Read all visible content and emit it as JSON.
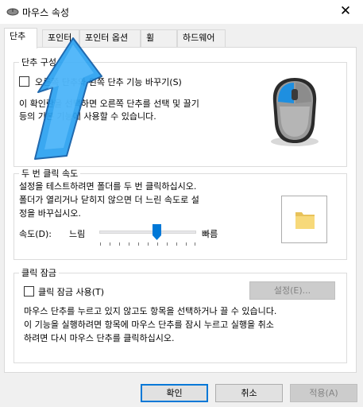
{
  "window": {
    "title": "마우스 속성",
    "close_glyph": "✕"
  },
  "tabs": [
    {
      "label": "단추",
      "active": true
    },
    {
      "label": "포인터"
    },
    {
      "label": "포인터 옵션"
    },
    {
      "label": "휠"
    },
    {
      "label": "하드웨어"
    }
  ],
  "button_config": {
    "legend": "단추 구성",
    "checkbox_label": "오른쪽 단추와 왼쪽 단추 기능 바꾸기(S)",
    "checked": false,
    "description_line1": "이 확인란을 선택하면 오른쪽 단추를 선택 및 끌기",
    "description_line2": "등의 기본 기능에 사용할 수 있습니다."
  },
  "double_click": {
    "legend": "두 번 클릭 속도",
    "line1": "설정을 테스트하려면 폴더를 두 번 클릭하십시오.",
    "line2": "폴더가 열리거나 닫히지 않으면 더 느린 속도로 설",
    "line3": "정을 바꾸십시오.",
    "speed_label": "속도(D):",
    "slow_label": "느림",
    "fast_label": "빠름",
    "speed_fraction": 0.6
  },
  "click_lock": {
    "legend": "클릭 잠금",
    "checkbox_label": "클릭 잠금 사용(T)",
    "checked": false,
    "settings_label": "설정(E)...",
    "line1": "마우스 단추를 누르고 있지 않고도 항목을 선택하거나 끌 수 있습니다.",
    "line2": "이 기능을 실행하려면 항목에 마우스 단추를 잠시 누르고 실행을 취소",
    "line3": "하려면 다시 마우스 단추를 클릭하십시오."
  },
  "footer": {
    "ok": "확인",
    "cancel": "취소",
    "apply": "적용(A)"
  },
  "colors": {
    "accent": "#0078d7",
    "overlay_arrow": "#2aa1f0"
  }
}
